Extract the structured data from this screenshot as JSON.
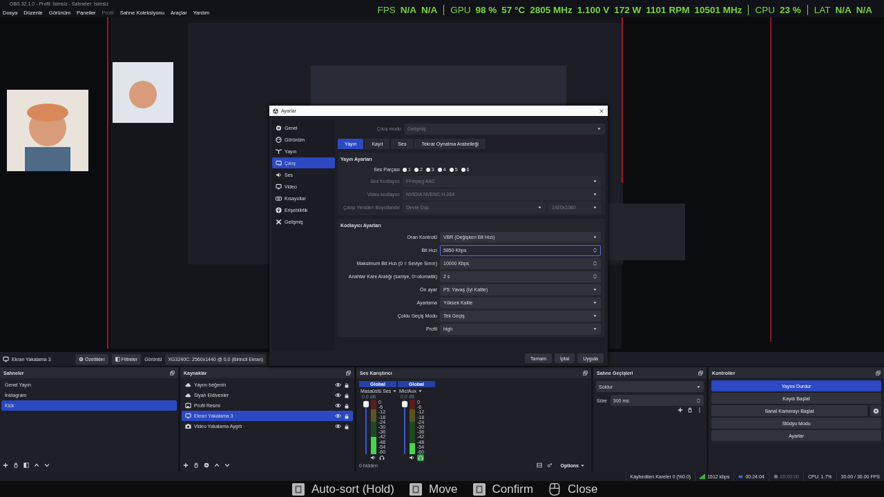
{
  "window": {
    "title": "OBS 32.1.0 - Profil: İsimsiz - Sahneler: İsimsiz"
  },
  "menu": [
    {
      "label": "Dosya",
      "disabled": false
    },
    {
      "label": "Düzenle",
      "disabled": false
    },
    {
      "label": "Görünüm",
      "disabled": false
    },
    {
      "label": "Paneller",
      "disabled": false
    },
    {
      "label": "Profil",
      "disabled": true
    },
    {
      "label": "Sahne Koleksiyonu",
      "disabled": false
    },
    {
      "label": "Araçlar",
      "disabled": false
    },
    {
      "label": "Yardım",
      "disabled": false
    }
  ],
  "perf_overlay": [
    {
      "label": "FPS",
      "values": [
        "N/A",
        "N/A"
      ]
    },
    {
      "label": "GPU",
      "values": [
        "98 %",
        "57 °C",
        "2805 MHz",
        "1.100 V",
        "172 W",
        "1101 RPM",
        "10501 MHz"
      ]
    },
    {
      "label": "CPU",
      "values": [
        "23 %"
      ]
    },
    {
      "label": "LAT",
      "values": [
        "N/A",
        "N/A"
      ]
    }
  ],
  "settings_dialog": {
    "title": "Ayarlar",
    "sidebar": [
      {
        "label": "Genel",
        "selected": false
      },
      {
        "label": "Görünüm",
        "selected": false
      },
      {
        "label": "Yayın",
        "selected": false
      },
      {
        "label": "Çıkış",
        "selected": true
      },
      {
        "label": "Ses",
        "selected": false
      },
      {
        "label": "Video",
        "selected": false
      },
      {
        "label": "Kısayollar",
        "selected": false
      },
      {
        "label": "Erişebilirlik",
        "selected": false
      },
      {
        "label": "Gelişmiş",
        "selected": false
      }
    ],
    "output_mode": {
      "label": "Çıkış modu",
      "value": "Gelişmiş",
      "kind": "select",
      "disabled": true,
      "focused": false
    },
    "tabs": [
      {
        "label": "Yayın",
        "selected": true
      },
      {
        "label": "Kayıt",
        "selected": false
      },
      {
        "label": "Ses",
        "selected": false
      },
      {
        "label": "Tekrar Oynatma Arabelleği",
        "selected": false
      }
    ],
    "stream_section": {
      "title": "Yayın Ayarları",
      "track_label": "Ses Parçası",
      "tracks": [
        {
          "label": "1",
          "checked": true
        },
        {
          "label": "2",
          "checked": true
        },
        {
          "label": "3",
          "checked": true
        },
        {
          "label": "4",
          "checked": true
        },
        {
          "label": "5",
          "checked": true
        },
        {
          "label": "6",
          "checked": true
        }
      ],
      "fields": [
        {
          "label": "Ses Kodlayıcı",
          "value": "FFmpeg AAC",
          "kind": "select",
          "disabled": true,
          "focused": false
        },
        {
          "label": "Video kodlayıcı",
          "value": "NVIDIA NVENC H.264",
          "kind": "select",
          "disabled": true,
          "focused": false
        },
        {
          "label": "Çıkışı Yeniden Boyutlandır",
          "value": "Devre Dışı",
          "value_2": "1920x1080",
          "kind": "select_pair",
          "disabled": true,
          "focused": false
        }
      ]
    },
    "encoder_section": {
      "title": "Kodlayıcı Ayarları",
      "fields": [
        {
          "label": "Oran Kontrolü",
          "value": "VBR (Değişken Bit Hızı)",
          "kind": "select",
          "disabled": false,
          "focused": false
        },
        {
          "label": "Bit Hızı",
          "value": "5850 Kbps",
          "kind": "spin",
          "disabled": false,
          "focused": true
        },
        {
          "label": "Maksimum Bit Hızı (0 = Seviye Sınırı)",
          "value": "10000 Kbps",
          "kind": "spin",
          "disabled": false,
          "focused": false
        },
        {
          "label": "Anahtar Kare Aralığı (saniye, 0=otomatik)",
          "value": "2 s",
          "kind": "spin",
          "disabled": false,
          "focused": false
        },
        {
          "label": "Ön ayar",
          "value": "P5: Yavaş (İyi Kalite)",
          "kind": "select",
          "disabled": false,
          "focused": false
        },
        {
          "label": "Ayarlama",
          "value": "Yüksek Kalite",
          "kind": "select",
          "disabled": false,
          "focused": false
        },
        {
          "label": "Çoklu Geçiş Modu",
          "value": "Tek Geçiş",
          "kind": "select",
          "disabled": false,
          "focused": false
        },
        {
          "label": "Profil",
          "value": "high",
          "kind": "select",
          "disabled": false,
          "focused": false
        }
      ]
    },
    "buttons": [
      "Tamam",
      "İptal",
      "Uygula"
    ]
  },
  "source_toolbar": {
    "source": "Ekran Yakalama 3",
    "buttons": [
      "Özellikler",
      "Filtreler"
    ],
    "display_label": "Görüntü",
    "display_value": "XG3240C: 2560x1440 @ 0.0 (Birincil Ekran)"
  },
  "scenes": {
    "title": "Sahneler",
    "items": [
      {
        "label": "Genel Yayın",
        "selected": false
      },
      {
        "label": "İnstagram",
        "selected": false
      },
      {
        "label": "Kick",
        "selected": true
      }
    ]
  },
  "sources": {
    "title": "Kaynaklar",
    "items": [
      {
        "label": "Yayını beğenin",
        "selected": false
      },
      {
        "label": "Siyah Eldivenler",
        "selected": false
      },
      {
        "label": "Profil Resmi",
        "selected": false
      },
      {
        "label": "Ekran Yakalama 3",
        "selected": true
      },
      {
        "label": "Video Yakalama Aygıtı",
        "selected": false
      }
    ]
  },
  "mixer": {
    "title": "Ses Karıştırıcı",
    "channels": [
      {
        "header": "Global",
        "name": "Masaüstü Ses",
        "db": "0.0 dB",
        "scale": [
          "0",
          "-6",
          "-12",
          "-18",
          "-24",
          "-30",
          "-36",
          "-42",
          "-48",
          "-54",
          "-60"
        ],
        "fader": {
          "level": 0.97
        },
        "meter": {
          "level": 0.32
        },
        "monitoring": false
      },
      {
        "header": "Global",
        "name": "Mic/Aux",
        "db": "0.0 dB",
        "scale": [
          "0",
          "-6",
          "-12",
          "-18",
          "-24",
          "-30",
          "-36",
          "-42",
          "-48",
          "-54",
          "-60"
        ],
        "fader": {
          "level": 0.97
        },
        "meter": {
          "level": 0.2
        },
        "monitoring": true
      }
    ],
    "hidden_label": "0 hidden",
    "options": "Options"
  },
  "transitions": {
    "title": "Sahne Geçişleri",
    "transition": "Soldur",
    "duration_label": "Süre",
    "duration": "300 ms"
  },
  "controls": {
    "title": "Kontroller",
    "buttons": [
      {
        "label": "Yayını Durdur",
        "active": true,
        "has_settings": false
      },
      {
        "label": "Kaydı Başlat",
        "active": false,
        "has_settings": false
      },
      {
        "label": "Sanal Kamerayı Başlat",
        "active": false,
        "has_settings": true
      },
      {
        "label": "Stüdyo Modu",
        "active": false,
        "has_settings": false
      },
      {
        "label": "Ayarlar",
        "active": false,
        "has_settings": false
      }
    ]
  },
  "status_bar": {
    "dropped_frames": "Kaybedilen Kareler 0 (%0.0)",
    "bitrate": "1512 kbps",
    "stream_time": "00:24:04",
    "record_time": "00:00:00",
    "cpu": "CPU: 1.7%",
    "fps": "30.00 / 30.00 FPS"
  },
  "hint_bar": [
    {
      "label": "Auto-sort (Hold)",
      "kind": "key"
    },
    {
      "label": "Move",
      "kind": "key"
    },
    {
      "label": "Confirm",
      "kind": "key"
    },
    {
      "label": "Close",
      "kind": "mouse"
    }
  ]
}
